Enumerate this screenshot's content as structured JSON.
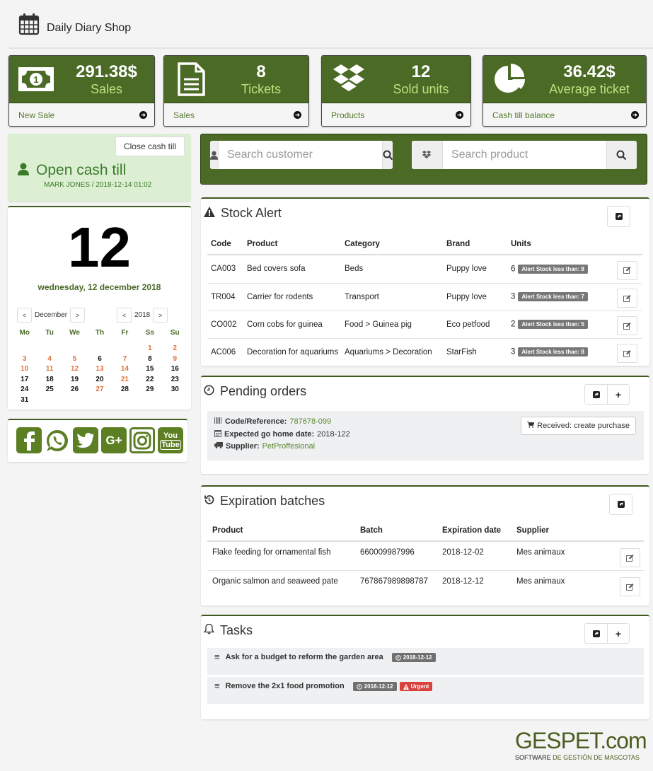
{
  "header": {
    "title": "Daily Diary Shop",
    "icon": "calendar-icon"
  },
  "stats": [
    {
      "value": "291.38$",
      "label": "Sales",
      "link": "New Sale",
      "icon": "money-bill-icon"
    },
    {
      "value": "8",
      "label": "Tickets",
      "link": "Sales",
      "icon": "document-icon"
    },
    {
      "value": "12",
      "label": "Sold units",
      "link": "Products",
      "icon": "dropbox-icon"
    },
    {
      "value": "36.42$",
      "label": "Average ticket",
      "link": "Cash till balance",
      "icon": "pie-chart-icon"
    }
  ],
  "cash_till": {
    "close_label": "Close cash till",
    "status": "Open cash till",
    "user_line": "MARK JONES / 2018-12-14 01:02"
  },
  "calendar": {
    "day": "12",
    "long_date": "wednesday, 12 december 2018",
    "month": "December",
    "year": "2018",
    "prev": "<",
    "next": ">",
    "weekdays": [
      "Mo",
      "Tu",
      "We",
      "Th",
      "Fr",
      "Ss",
      "Su"
    ],
    "leading_blanks": 5,
    "days": [
      {
        "n": "1",
        "hl": true
      },
      {
        "n": "2",
        "hl": true
      },
      {
        "n": "3",
        "hl": true
      },
      {
        "n": "4",
        "hl": true
      },
      {
        "n": "5",
        "hl": true
      },
      {
        "n": "6",
        "hl": false
      },
      {
        "n": "7",
        "hl": true
      },
      {
        "n": "8",
        "hl": false
      },
      {
        "n": "9",
        "hl": true
      },
      {
        "n": "10",
        "hl": true
      },
      {
        "n": "11",
        "hl": true
      },
      {
        "n": "12",
        "hl": true
      },
      {
        "n": "13",
        "hl": true
      },
      {
        "n": "14",
        "hl": true
      },
      {
        "n": "15",
        "hl": false
      },
      {
        "n": "16",
        "hl": false
      },
      {
        "n": "17",
        "hl": false
      },
      {
        "n": "18",
        "hl": false
      },
      {
        "n": "19",
        "hl": false
      },
      {
        "n": "20",
        "hl": false
      },
      {
        "n": "21",
        "hl": true
      },
      {
        "n": "22",
        "hl": false
      },
      {
        "n": "23",
        "hl": false
      },
      {
        "n": "24",
        "hl": false
      },
      {
        "n": "25",
        "hl": false
      },
      {
        "n": "26",
        "hl": false
      },
      {
        "n": "27",
        "hl": true
      },
      {
        "n": "28",
        "hl": false
      },
      {
        "n": "29",
        "hl": false
      },
      {
        "n": "30",
        "hl": false
      },
      {
        "n": "31",
        "hl": false
      }
    ]
  },
  "social": [
    "facebook",
    "whatsapp",
    "twitter",
    "google-plus",
    "instagram",
    "youtube"
  ],
  "search": {
    "customer_placeholder": "Search customer",
    "product_placeholder": "Search product"
  },
  "stock_alert": {
    "title": "Stock Alert",
    "columns": [
      "Code",
      "Product",
      "Category",
      "Brand",
      "Units"
    ],
    "rows": [
      {
        "code": "CA003",
        "product": "Bed covers sofa",
        "category": "Beds",
        "brand": "Puppy love",
        "units": "6",
        "alert": "Alert Stock less than: 8"
      },
      {
        "code": "TR004",
        "product": "Carrier for rodents",
        "category": "Transport",
        "brand": "Puppy love",
        "units": "3",
        "alert": "Alert Stock less than: 7"
      },
      {
        "code": "CO002",
        "product": "Corn cobs for guinea",
        "category": "Food > Guinea pig",
        "brand": "Eco petfood",
        "units": "2",
        "alert": "Alert Stock less than: 5"
      },
      {
        "code": "AC006",
        "product": "Decoration for aquariums",
        "category": "Aquariums > Decoration",
        "brand": "StarFish",
        "units": "3",
        "alert": "Alert Stock less than: 8"
      }
    ]
  },
  "pending_orders": {
    "title": "Pending orders",
    "code_label": "Code/Reference:",
    "code_value": "787678-099",
    "date_label": "Expected go home date:",
    "date_value": "2018-122",
    "supplier_label": "Supplier:",
    "supplier_value": "PetProffesional",
    "action": "Received: create purchase"
  },
  "expiration": {
    "title": "Expiration batches",
    "columns": [
      "Product",
      "Batch",
      "Expiration date",
      "Supplier"
    ],
    "rows": [
      {
        "product": "Flake feeding for ornamental fish",
        "batch": "660009987996",
        "date": "2018-12-02",
        "supplier": "Mes animaux"
      },
      {
        "product": "Organic salmon and seaweed pate",
        "batch": "767867989898787",
        "date": "2018-12-12",
        "supplier": "Mes animaux"
      }
    ]
  },
  "tasks": {
    "title": "Tasks",
    "items": [
      {
        "text": "Ask for a budget to reform the garden area",
        "date": "2018-12-12",
        "urgent": null
      },
      {
        "text": "Remove the 2x1 food promotion",
        "date": "2018-12-12",
        "urgent": "Urgent"
      }
    ]
  },
  "brand": {
    "logo": "GESPET",
    "logo_suffix": ".com",
    "sub_a": "SOFTWARE",
    "sub_b": " DE GESTIÓN DE MASCOTAS"
  },
  "colors": {
    "primary": "#4a6a25",
    "accent_light": "#b9e27e",
    "highlight": "#e2703a",
    "danger": "#d9413e"
  }
}
